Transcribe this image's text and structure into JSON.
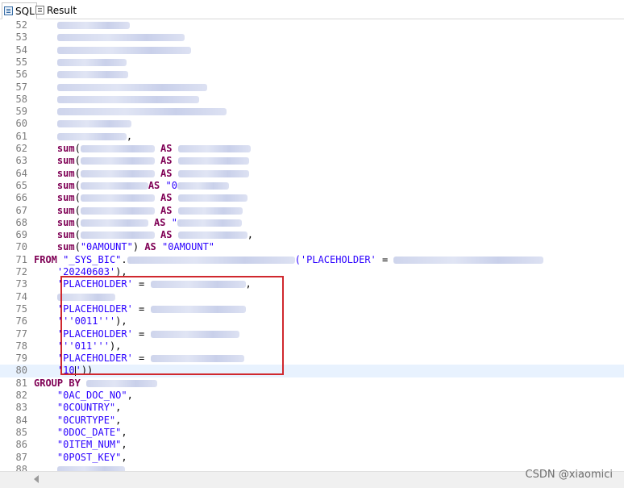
{
  "tabs": [
    {
      "label": "SQL",
      "icon": "sql-editor-icon",
      "active": true
    },
    {
      "label": "Result",
      "icon": "result-grid-icon",
      "active": false
    }
  ],
  "editor": {
    "current_line": "80",
    "lines": [
      {
        "num": "52",
        "segments": [
          {
            "t": "    ",
            "c": "plain"
          },
          {
            "t": "",
            "c": "blur",
            "w": 90
          }
        ]
      },
      {
        "num": "53",
        "segments": [
          {
            "t": "    ",
            "c": "plain"
          },
          {
            "t": "",
            "c": "blur",
            "w": 158
          }
        ]
      },
      {
        "num": "54",
        "segments": [
          {
            "t": "    ",
            "c": "plain"
          },
          {
            "t": "",
            "c": "blur",
            "w": 166
          }
        ]
      },
      {
        "num": "55",
        "segments": [
          {
            "t": "    ",
            "c": "plain"
          },
          {
            "t": "",
            "c": "blur",
            "w": 86
          }
        ]
      },
      {
        "num": "56",
        "segments": [
          {
            "t": "    ",
            "c": "plain"
          },
          {
            "t": "",
            "c": "blur",
            "w": 88
          }
        ]
      },
      {
        "num": "57",
        "segments": [
          {
            "t": "    ",
            "c": "plain"
          },
          {
            "t": "",
            "c": "blur",
            "w": 186
          }
        ]
      },
      {
        "num": "58",
        "segments": [
          {
            "t": "    ",
            "c": "plain"
          },
          {
            "t": "",
            "c": "blur",
            "w": 176
          }
        ]
      },
      {
        "num": "59",
        "segments": [
          {
            "t": "    ",
            "c": "plain"
          },
          {
            "t": "",
            "c": "blur",
            "w": 210
          }
        ]
      },
      {
        "num": "60",
        "segments": [
          {
            "t": "    ",
            "c": "plain"
          },
          {
            "t": "",
            "c": "blur",
            "w": 92
          }
        ]
      },
      {
        "num": "61",
        "segments": [
          {
            "t": "    ",
            "c": "plain"
          },
          {
            "t": "",
            "c": "blur",
            "w": 86
          },
          {
            "t": ",",
            "c": "plain"
          }
        ]
      },
      {
        "num": "62",
        "segments": [
          {
            "t": "    ",
            "c": "plain"
          },
          {
            "t": "sum",
            "c": "kw"
          },
          {
            "t": "(",
            "c": "plain"
          },
          {
            "t": "",
            "c": "blur",
            "w": 92
          },
          {
            "t": " AS ",
            "c": "kw"
          },
          {
            "t": "",
            "c": "blur",
            "w": 90
          }
        ]
      },
      {
        "num": "63",
        "segments": [
          {
            "t": "    ",
            "c": "plain"
          },
          {
            "t": "sum",
            "c": "kw"
          },
          {
            "t": "(",
            "c": "plain"
          },
          {
            "t": "",
            "c": "blur",
            "w": 92
          },
          {
            "t": " AS ",
            "c": "kw"
          },
          {
            "t": "",
            "c": "blur",
            "w": 88
          }
        ]
      },
      {
        "num": "64",
        "segments": [
          {
            "t": "    ",
            "c": "plain"
          },
          {
            "t": "sum",
            "c": "kw"
          },
          {
            "t": "(",
            "c": "plain"
          },
          {
            "t": "",
            "c": "blur",
            "w": 92
          },
          {
            "t": " AS ",
            "c": "kw"
          },
          {
            "t": "",
            "c": "blur",
            "w": 88
          }
        ]
      },
      {
        "num": "65",
        "segments": [
          {
            "t": "    ",
            "c": "plain"
          },
          {
            "t": "sum",
            "c": "kw"
          },
          {
            "t": "(",
            "c": "plain"
          },
          {
            "t": "",
            "c": "blur",
            "w": 84
          },
          {
            "t": "AS ",
            "c": "kw"
          },
          {
            "t": "\"0",
            "c": "str"
          },
          {
            "t": "",
            "c": "blur",
            "w": 64
          }
        ]
      },
      {
        "num": "66",
        "segments": [
          {
            "t": "    ",
            "c": "plain"
          },
          {
            "t": "sum",
            "c": "kw"
          },
          {
            "t": "(",
            "c": "plain"
          },
          {
            "t": "",
            "c": "blur",
            "w": 92
          },
          {
            "t": " AS ",
            "c": "kw"
          },
          {
            "t": "",
            "c": "blur",
            "w": 86
          }
        ]
      },
      {
        "num": "67",
        "segments": [
          {
            "t": "    ",
            "c": "plain"
          },
          {
            "t": "sum",
            "c": "kw"
          },
          {
            "t": "(",
            "c": "plain"
          },
          {
            "t": "",
            "c": "blur",
            "w": 92
          },
          {
            "t": " AS ",
            "c": "kw"
          },
          {
            "t": "",
            "c": "blur",
            "w": 80
          }
        ]
      },
      {
        "num": "68",
        "segments": [
          {
            "t": "    ",
            "c": "plain"
          },
          {
            "t": "sum",
            "c": "kw"
          },
          {
            "t": "(",
            "c": "plain"
          },
          {
            "t": "",
            "c": "blur",
            "w": 84
          },
          {
            "t": " AS ",
            "c": "kw"
          },
          {
            "t": "\"",
            "c": "str"
          },
          {
            "t": "",
            "c": "blur",
            "w": 80
          }
        ]
      },
      {
        "num": "69",
        "segments": [
          {
            "t": "    ",
            "c": "plain"
          },
          {
            "t": "sum",
            "c": "kw"
          },
          {
            "t": "(",
            "c": "plain"
          },
          {
            "t": "",
            "c": "blur",
            "w": 92
          },
          {
            "t": " AS ",
            "c": "kw"
          },
          {
            "t": "",
            "c": "blur",
            "w": 86
          },
          {
            "t": ",",
            "c": "plain"
          }
        ]
      },
      {
        "num": "70",
        "segments": [
          {
            "t": "    ",
            "c": "plain"
          },
          {
            "t": "sum",
            "c": "kw"
          },
          {
            "t": "(",
            "c": "plain"
          },
          {
            "t": "\"0AMOUNT\"",
            "c": "str"
          },
          {
            "t": ") ",
            "c": "plain"
          },
          {
            "t": "AS",
            "c": "kw"
          },
          {
            "t": " ",
            "c": "plain"
          },
          {
            "t": "\"0AMOUNT\"",
            "c": "str"
          }
        ]
      },
      {
        "num": "71",
        "segments": [
          {
            "t": "FROM",
            "c": "kw"
          },
          {
            "t": " ",
            "c": "plain"
          },
          {
            "t": "\"_SYS_BIC\"",
            "c": "str"
          },
          {
            "t": ".",
            "c": "plain"
          },
          {
            "t": "",
            "c": "blur",
            "w": 208
          },
          {
            "t": "('PLACEHOLDER'",
            "c": "str"
          },
          {
            "t": " = ",
            "c": "plain"
          },
          {
            "t": "",
            "c": "blur",
            "w": 186
          }
        ]
      },
      {
        "num": "72",
        "segments": [
          {
            "t": "    ",
            "c": "plain"
          },
          {
            "t": "'20240603'",
            "c": "str"
          },
          {
            "t": "),",
            "c": "plain"
          }
        ]
      },
      {
        "num": "73",
        "segments": [
          {
            "t": "    ",
            "c": "plain"
          },
          {
            "t": "'PLACEHOLDER'",
            "c": "str"
          },
          {
            "t": " = ",
            "c": "plain"
          },
          {
            "t": "",
            "c": "blur",
            "w": 118
          },
          {
            "t": ",",
            "c": "plain"
          }
        ]
      },
      {
        "num": "74",
        "segments": [
          {
            "t": "    ",
            "c": "plain"
          },
          {
            "t": "",
            "c": "blur",
            "w": 72
          }
        ]
      },
      {
        "num": "75",
        "segments": [
          {
            "t": "    ",
            "c": "plain"
          },
          {
            "t": "'PLACEHOLDER'",
            "c": "str"
          },
          {
            "t": " = ",
            "c": "plain"
          },
          {
            "t": "",
            "c": "blur",
            "w": 118
          }
        ]
      },
      {
        "num": "76",
        "segments": [
          {
            "t": "    ",
            "c": "plain"
          },
          {
            "t": "'''0011'''",
            "c": "str"
          },
          {
            "t": "),",
            "c": "plain"
          }
        ]
      },
      {
        "num": "77",
        "segments": [
          {
            "t": "    ",
            "c": "plain"
          },
          {
            "t": "'PLACEHOLDER'",
            "c": "str"
          },
          {
            "t": " = ",
            "c": "plain"
          },
          {
            "t": "",
            "c": "blur",
            "w": 110
          }
        ]
      },
      {
        "num": "78",
        "segments": [
          {
            "t": "    ",
            "c": "plain"
          },
          {
            "t": "'''011'''",
            "c": "str"
          },
          {
            "t": "),",
            "c": "plain"
          }
        ]
      },
      {
        "num": "79",
        "segments": [
          {
            "t": "    ",
            "c": "plain"
          },
          {
            "t": "'PLACEHOLDER'",
            "c": "str"
          },
          {
            "t": " = ",
            "c": "plain"
          },
          {
            "t": "",
            "c": "blur",
            "w": 116
          }
        ]
      },
      {
        "num": "80",
        "segments": [
          {
            "t": "    ",
            "c": "plain"
          },
          {
            "t": "'10",
            "c": "str"
          },
          {
            "t": "",
            "c": "caret"
          },
          {
            "t": "'",
            "c": "str"
          },
          {
            "t": "))",
            "c": "plain"
          }
        ]
      },
      {
        "num": "81",
        "segments": [
          {
            "t": "GROUP BY",
            "c": "kw"
          },
          {
            "t": " ",
            "c": "plain"
          },
          {
            "t": "",
            "c": "blur",
            "w": 88
          }
        ]
      },
      {
        "num": "82",
        "segments": [
          {
            "t": "    ",
            "c": "plain"
          },
          {
            "t": "\"0AC_DOC_NO\"",
            "c": "str"
          },
          {
            "t": ",",
            "c": "plain"
          }
        ]
      },
      {
        "num": "83",
        "segments": [
          {
            "t": "    ",
            "c": "plain"
          },
          {
            "t": "\"0COUNTRY\"",
            "c": "str"
          },
          {
            "t": ",",
            "c": "plain"
          }
        ]
      },
      {
        "num": "84",
        "segments": [
          {
            "t": "    ",
            "c": "plain"
          },
          {
            "t": "\"0CURTYPE\"",
            "c": "str"
          },
          {
            "t": ",",
            "c": "plain"
          }
        ]
      },
      {
        "num": "85",
        "segments": [
          {
            "t": "    ",
            "c": "plain"
          },
          {
            "t": "\"0DOC_DATE\"",
            "c": "str"
          },
          {
            "t": ",",
            "c": "plain"
          }
        ]
      },
      {
        "num": "86",
        "segments": [
          {
            "t": "    ",
            "c": "plain"
          },
          {
            "t": "\"0ITEM_NUM\"",
            "c": "str"
          },
          {
            "t": ",",
            "c": "plain"
          }
        ]
      },
      {
        "num": "87",
        "segments": [
          {
            "t": "    ",
            "c": "plain"
          },
          {
            "t": "\"0POST_KEY\"",
            "c": "str"
          },
          {
            "t": ",",
            "c": "plain"
          }
        ]
      },
      {
        "num": "88",
        "segments": [
          {
            "t": "    ",
            "c": "plain"
          },
          {
            "t": "",
            "c": "blur",
            "w": 84
          }
        ]
      }
    ]
  },
  "highlight": {
    "color": "#d0282e"
  },
  "watermark": "CSDN @xiaomici"
}
